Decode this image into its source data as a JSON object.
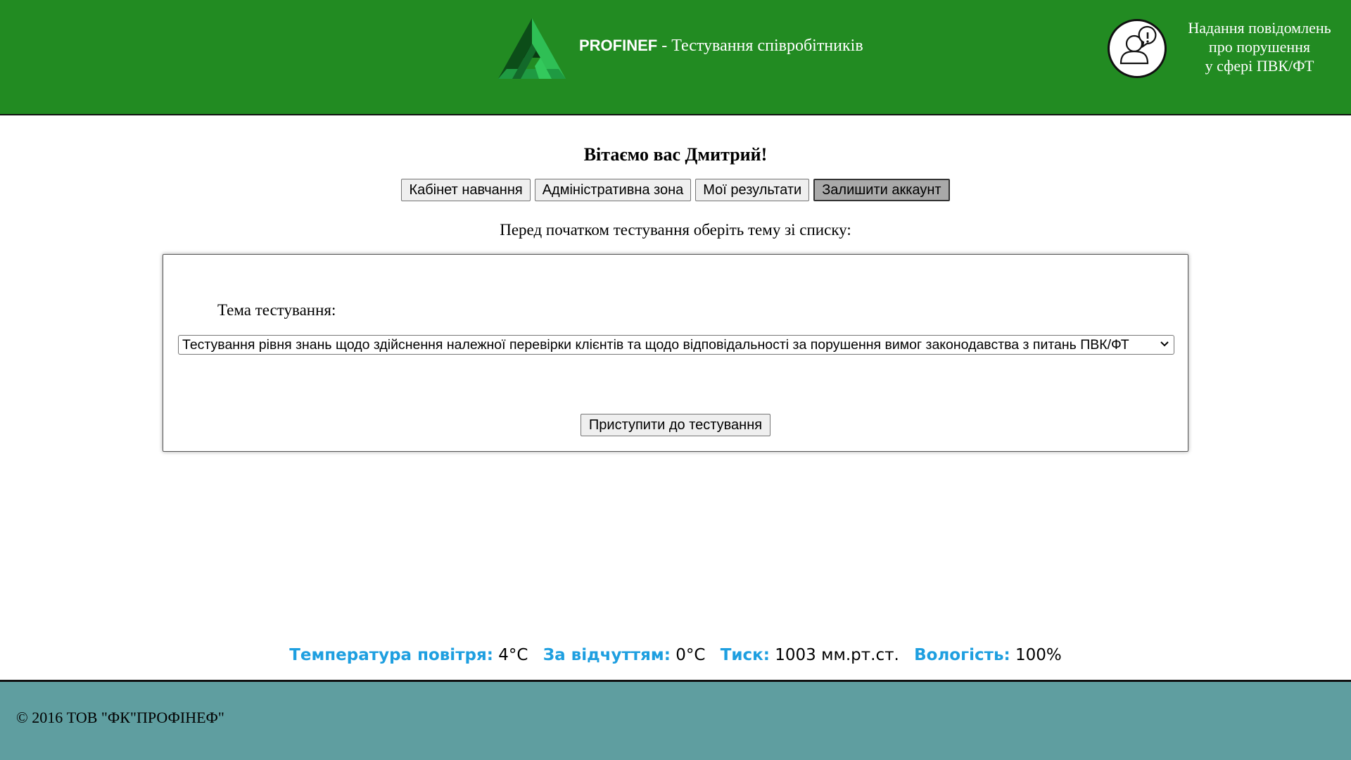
{
  "header": {
    "brand_name": "PROFINEF",
    "brand_suffix": " - Тестування співробітників",
    "report_line1": "Надання повідомлень",
    "report_line2": "про порушення",
    "report_line3": "у сфері ПВК/ФТ"
  },
  "main": {
    "welcome": "Вітаємо вас Дмитрий!",
    "nav": [
      {
        "label": "Кабінет навчання"
      },
      {
        "label": "Адміністративна зона"
      },
      {
        "label": "Мої результати"
      },
      {
        "label": "Залишити аккаунт"
      }
    ],
    "instruction": "Перед початком тестування оберіть тему зі списку:",
    "topic_label": "Тема тестування:",
    "topic_selected": "Тестування рівня знань щодо здійснення належної перевірки клієнтів та щодо відповідальності за порушення вимог законодавства з питань ПВК/ФТ",
    "start_button": "Приступити до тестування"
  },
  "weather": {
    "temp_label": "Температура повітря:",
    "temp_value": "4°C",
    "feels_label": "За відчуттям:",
    "feels_value": "0°C",
    "pressure_label": "Тиск:",
    "pressure_value": "1003 мм.рт.ст.",
    "humidity_label": "Вологість:",
    "humidity_value": "100%"
  },
  "footer": {
    "copyright": "© 2016 ТОВ \"ФК\"ПРОФІНЕФ\""
  },
  "colors": {
    "header_bg": "#228B22",
    "footer_bg": "#5F9EA0",
    "weather_label": "#1E9FE0"
  }
}
